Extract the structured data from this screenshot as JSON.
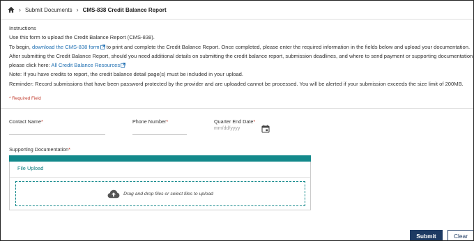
{
  "breadcrumb": {
    "home_icon": "home-icon",
    "items": [
      "Submit Documents",
      "CMS-838 Credit Balance Report"
    ]
  },
  "instructions": {
    "heading": "Instructions",
    "line1": "Use this form to upload the Credit Balance Report (CMS-838).",
    "line2_pre": "To begin, ",
    "line2_link": "download the CMS-838 form",
    "line2_post": " to print and complete the Credit Balance Report. Once completed, please enter the required information in the fields below and upload your documentation.",
    "line3": "After submitting the Credit Balance Report, should you need additional details on submitting the credit balance report, submission deadlines, and where to send payment or supporting documentation,",
    "line4_pre": "please click here: ",
    "line4_link": "All Credit Balance Resources",
    "line5": "Note: If you have credits to report, the credit balance detail page(s) must be included in your upload.",
    "line6": "Reminder: Record submissions that have been password protected by the provider and are uploaded cannot be processed. You will be alerted if your submission exceeds the size limit of 200MB."
  },
  "required_note": "* Required Field",
  "fields": {
    "contact_name": {
      "label": "Contact Name",
      "value": ""
    },
    "phone_number": {
      "label": "Phone Number",
      "value": ""
    },
    "quarter_end_date": {
      "label": "Quarter End Date",
      "placeholder": "mm/dd/yyyy"
    },
    "required_marker": "*"
  },
  "supporting": {
    "label": "Supporting Documentation",
    "panel_title": "File Upload",
    "drop_text": "Drag and drop files or select files to upload",
    "accent_color": "#13898b"
  },
  "actions": {
    "submit_label": "Submit",
    "clear_label": "Clear",
    "primary_color": "#1d3a63"
  }
}
